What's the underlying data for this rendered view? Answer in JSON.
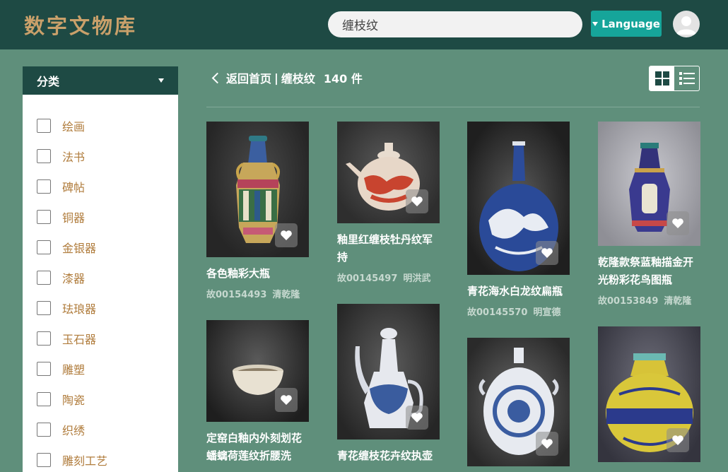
{
  "header": {
    "logo": "数字文物库",
    "search_value": "缠枝纹",
    "language_label": "Language"
  },
  "sidebar": {
    "title": "分类",
    "categories": [
      "绘画",
      "法书",
      "碑帖",
      "铜器",
      "金银器",
      "漆器",
      "珐琅器",
      "玉石器",
      "雕塑",
      "陶瓷",
      "织绣",
      "雕刻工艺"
    ]
  },
  "results": {
    "back_label": "返回首页",
    "separator": "|",
    "keyword": "缠枝纹",
    "count": "140 件"
  },
  "items": [
    {
      "title": "各色釉彩大瓶",
      "id": "故00154493",
      "dynasty": "清乾隆"
    },
    {
      "title": "釉里红缠枝牡丹纹军持",
      "id": "故00145497",
      "dynasty": "明洪武"
    },
    {
      "title": "青花海水白龙纹扁瓶",
      "id": "故00145570",
      "dynasty": "明宣德"
    },
    {
      "title": "乾隆款祭蓝釉描金开光粉彩花鸟图瓶",
      "id": "故00153849",
      "dynasty": "清乾隆"
    },
    {
      "title": "定窑白釉内外刻划花蟠螭荷莲纹折腰洗",
      "id": "",
      "dynasty": ""
    },
    {
      "title": "青花缠枝花卉纹执壶",
      "id": "",
      "dynasty": ""
    },
    {
      "title": "",
      "id": "",
      "dynasty": ""
    },
    {
      "title": "",
      "id": "",
      "dynasty": ""
    }
  ]
}
